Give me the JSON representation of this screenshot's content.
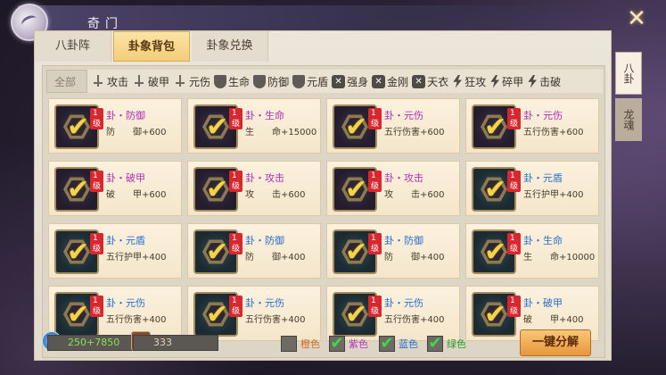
{
  "window": {
    "title": "奇门",
    "close_label": "✕"
  },
  "top_tabs": [
    {
      "label": "八卦阵",
      "active": false
    },
    {
      "label": "卦象背包",
      "active": true
    },
    {
      "label": "卦象兑换",
      "active": false
    }
  ],
  "side_tabs": [
    {
      "label": "八卦",
      "active": true
    },
    {
      "label": "龙魂",
      "active": false
    }
  ],
  "filters": [
    {
      "label": "全部",
      "icon": ""
    },
    {
      "label": "攻击",
      "icon": "sword-icon"
    },
    {
      "label": "破甲",
      "icon": "sword-icon"
    },
    {
      "label": "元伤",
      "icon": "sword-icon"
    },
    {
      "label": "生命",
      "icon": "shield-icon"
    },
    {
      "label": "防御",
      "icon": "shield-icon"
    },
    {
      "label": "元盾",
      "icon": "shield-icon"
    },
    {
      "label": "强身",
      "icon": "cross-shield-icon"
    },
    {
      "label": "金刚",
      "icon": "cross-shield-icon"
    },
    {
      "label": "天衣",
      "icon": "cross-shield-icon"
    },
    {
      "label": "狂攻",
      "icon": "bolt-icon"
    },
    {
      "label": "碎甲",
      "icon": "bolt-icon"
    },
    {
      "label": "击破",
      "icon": "bolt-icon"
    }
  ],
  "items": [
    {
      "level": "1级",
      "name": "卦・防御",
      "stat": "防　　御+600",
      "color": "purple",
      "checked": true
    },
    {
      "level": "1级",
      "name": "卦・生命",
      "stat": "生　　命+15000",
      "color": "purple",
      "checked": true
    },
    {
      "level": "1级",
      "name": "卦・元伤",
      "stat": "五行伤害+600",
      "color": "purple",
      "checked": true
    },
    {
      "level": "1级",
      "name": "卦・元伤",
      "stat": "五行伤害+600",
      "color": "purple",
      "checked": true
    },
    {
      "level": "1级",
      "name": "卦・破甲",
      "stat": "破　　甲+600",
      "color": "purple",
      "checked": true
    },
    {
      "level": "1级",
      "name": "卦・攻击",
      "stat": "攻　　击+600",
      "color": "purple",
      "checked": true
    },
    {
      "level": "1级",
      "name": "卦・攻击",
      "stat": "攻　　击+600",
      "color": "purple",
      "checked": true
    },
    {
      "level": "1级",
      "name": "卦・元盾",
      "stat": "五行护甲+400",
      "color": "blue",
      "checked": true
    },
    {
      "level": "1级",
      "name": "卦・元盾",
      "stat": "五行护甲+400",
      "color": "blue",
      "checked": true
    },
    {
      "level": "1级",
      "name": "卦・防御",
      "stat": "防　　御+400",
      "color": "blue",
      "checked": true
    },
    {
      "level": "1级",
      "name": "卦・防御",
      "stat": "防　　御+400",
      "color": "blue",
      "checked": true
    },
    {
      "level": "1级",
      "name": "卦・生命",
      "stat": "生　　命+10000",
      "color": "blue",
      "checked": true
    },
    {
      "level": "1级",
      "name": "卦・元伤",
      "stat": "五行伤害+400",
      "color": "blue",
      "checked": true
    },
    {
      "level": "1级",
      "name": "卦・元伤",
      "stat": "五行伤害+400",
      "color": "blue",
      "checked": true
    },
    {
      "level": "1级",
      "name": "卦・元伤",
      "stat": "五行伤害+400",
      "color": "blue",
      "checked": true
    },
    {
      "level": "1级",
      "name": "卦・破甲",
      "stat": "破　　甲+400",
      "color": "blue",
      "checked": true
    }
  ],
  "resources": {
    "orb_value": "250+7850",
    "box_value": "333"
  },
  "color_filters": [
    {
      "label": "橙色",
      "checked": false
    },
    {
      "label": "紫色",
      "checked": true
    },
    {
      "label": "蓝色",
      "checked": true
    },
    {
      "label": "绿色",
      "checked": true
    }
  ],
  "decompose_label": "一键分解",
  "check_glyph": "✔"
}
